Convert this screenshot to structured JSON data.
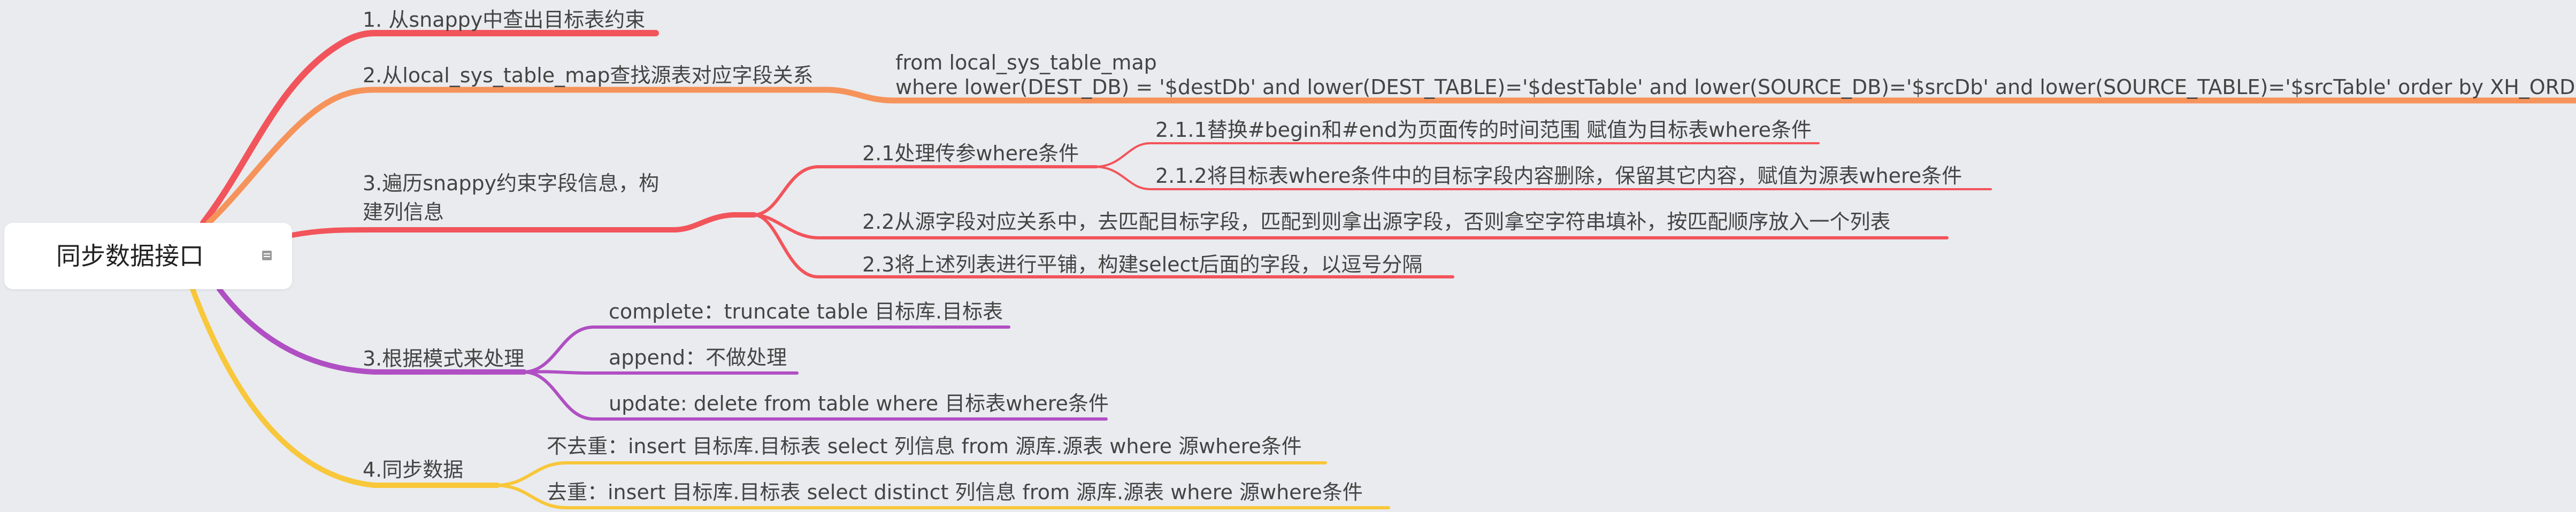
{
  "root": {
    "label": "同步数据接口"
  },
  "colors": {
    "red": "#f2545b",
    "orange": "#f6935a",
    "purple": "#b04fc3",
    "yellow": "#f8c73a",
    "text": "#444444"
  },
  "icons": {
    "root_note": "note-icon"
  },
  "branches": [
    {
      "label": "1. 从snappy中查出目标表约束"
    },
    {
      "label": "2.从local_sys_table_map查找源表对应字段关系",
      "detail": {
        "line1": "from local_sys_table_map",
        "line2": "where lower(DEST_DB) = '$destDb' and lower(DEST_TABLE)='$destTable'  and lower(SOURCE_DB)='$srcDb'  and lower(SOURCE_TABLE)='$srcTable'  order by XH_ORDER"
      }
    },
    {
      "label_line1": "3.遍历snappy约束字段信息，构",
      "label_line2": "建列信息",
      "children": [
        {
          "label": "2.1处理传参where条件",
          "children": [
            {
              "label": "2.1.1替换#begin和#end为页面传的时间范围 赋值为目标表where条件"
            },
            {
              "label": "2.1.2将目标表where条件中的目标字段内容删除，保留其它内容，赋值为源表where条件"
            }
          ]
        },
        {
          "label": "2.2从源字段对应关系中，去匹配目标字段，匹配到则拿出源字段，否则拿空字符串填补，按匹配顺序放入一个列表"
        },
        {
          "label": "2.3将上述列表进行平铺，构建select后面的字段，以逗号分隔"
        }
      ]
    },
    {
      "label": "3.根据模式来处理",
      "children": [
        {
          "label": "complete：truncate table 目标库.目标表"
        },
        {
          "label": "append：不做处理"
        },
        {
          "label": "update: delete from table where 目标表where条件"
        }
      ]
    },
    {
      "label": "4.同步数据",
      "children": [
        {
          "label": "不去重：insert 目标库.目标表 select 列信息 from 源库.源表 where  源where条件"
        },
        {
          "label": "去重：insert 目标库.目标表 select distinct 列信息 from 源库.源表 where  源where条件"
        }
      ]
    }
  ]
}
